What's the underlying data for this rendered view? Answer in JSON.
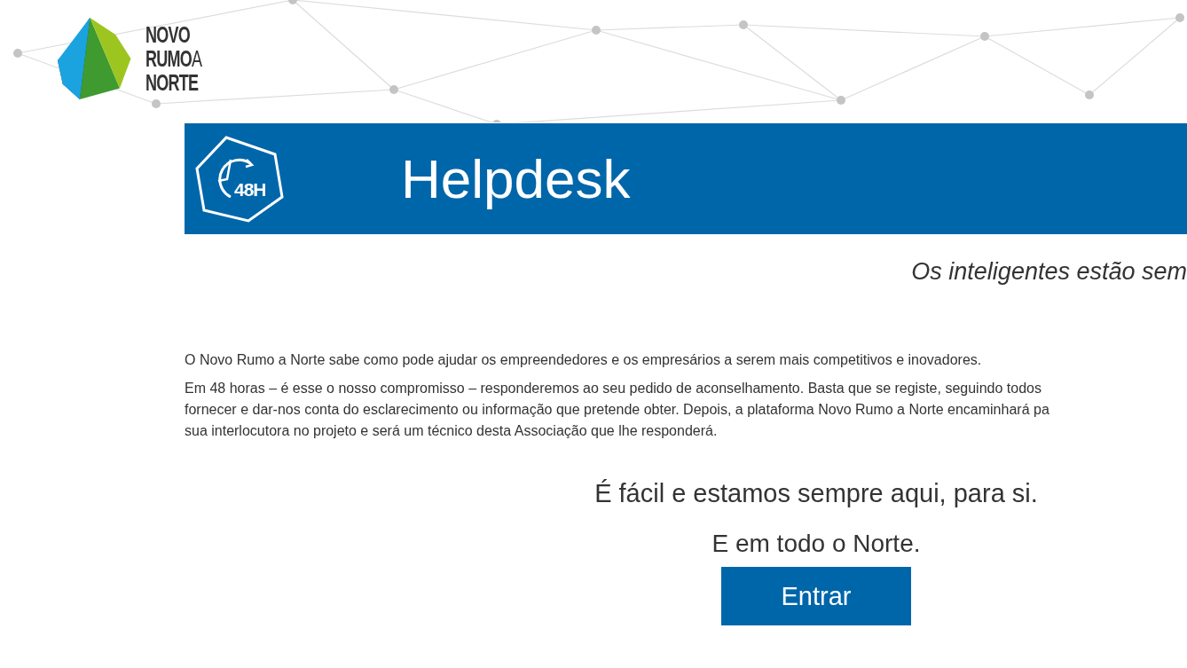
{
  "logo": {
    "line1": "NOVO",
    "line2": "RUMO",
    "line2_suffix": "A",
    "line3": "NORTE"
  },
  "banner": {
    "icon_text": "48H",
    "title": "Helpdesk"
  },
  "tagline": "Os inteligentes estão sem",
  "paragraphs": [
    {
      "lines": [
        "O Novo Rumo a Norte sabe como pode ajudar os empreendedores e os empresários a serem mais competitivos e inovadores."
      ]
    },
    {
      "lines": [
        "Em 48 horas – é esse o nosso compromisso – responderemos ao seu pedido de aconselhamento. Basta que se registe, seguindo todos",
        "fornecer e dar-nos conta do esclarecimento ou informação que pretende obter. Depois, a plataforma Novo Rumo a Norte encaminhará pa",
        "sua interlocutora no projeto e será um técnico desta Associação que lhe responderá."
      ]
    }
  ],
  "headline": "É fácil e estamos sempre aqui, para si.",
  "subline": "E em todo o Norte.",
  "button": "Entrar"
}
